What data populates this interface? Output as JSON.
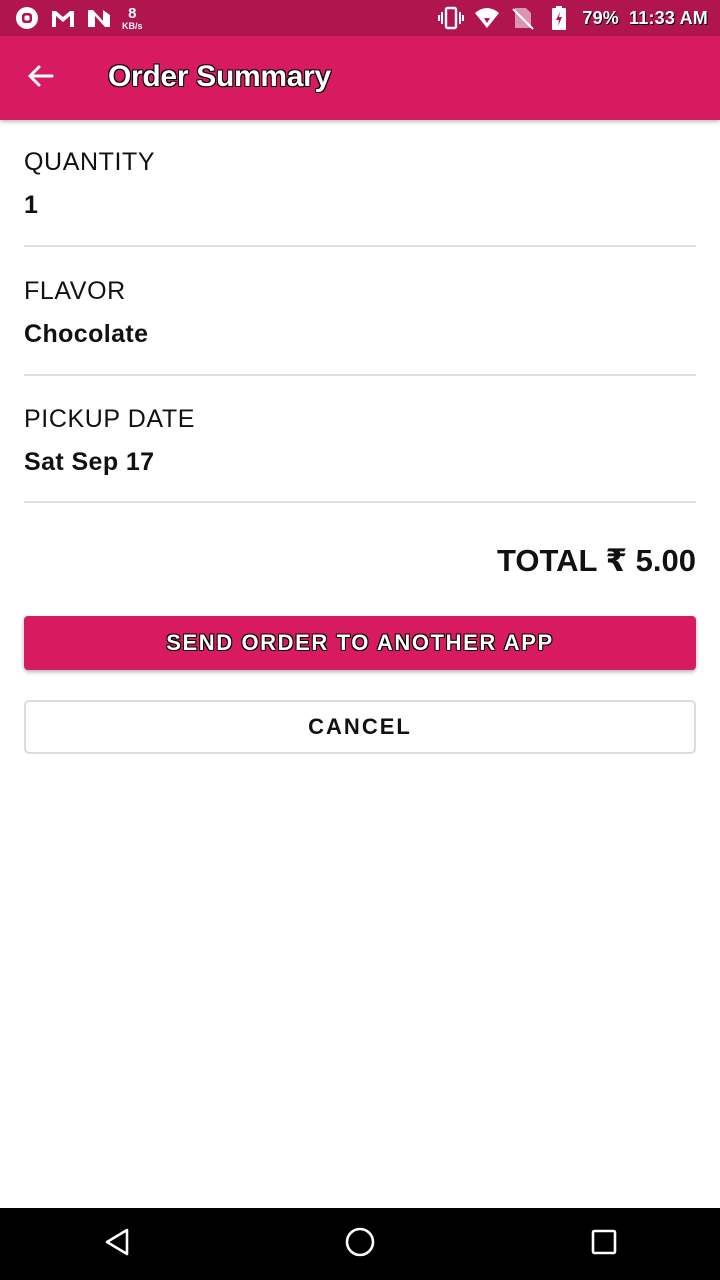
{
  "status_bar": {
    "icons": [
      "notification-o-icon",
      "gmail-icon",
      "n-app-icon",
      "vibrate-icon",
      "wifi-icon",
      "no-sim-icon",
      "battery-charging-icon"
    ],
    "net_speed_value": "8",
    "net_speed_unit": "KB/s",
    "battery": "79%",
    "time": "11:33 AM"
  },
  "app_bar": {
    "title": "Order Summary",
    "back_icon": "arrow-back-icon"
  },
  "summary": {
    "quantity_label": "QUANTITY",
    "quantity_value": "1",
    "flavor_label": "FLAVOR",
    "flavor_value": "Chocolate",
    "pickup_label": "PICKUP DATE",
    "pickup_value": "Sat Sep 17"
  },
  "total": "TOTAL ₹ 5.00",
  "actions": {
    "send_label": "SEND ORDER TO ANOTHER APP",
    "cancel_label": "CANCEL"
  },
  "nav_bar": {
    "icons": [
      "back-triangle-icon",
      "home-circle-icon",
      "recents-square-icon"
    ]
  },
  "colors": {
    "status_bar": "#b0154e",
    "primary": "#d81b60",
    "divider": "#dedede"
  }
}
